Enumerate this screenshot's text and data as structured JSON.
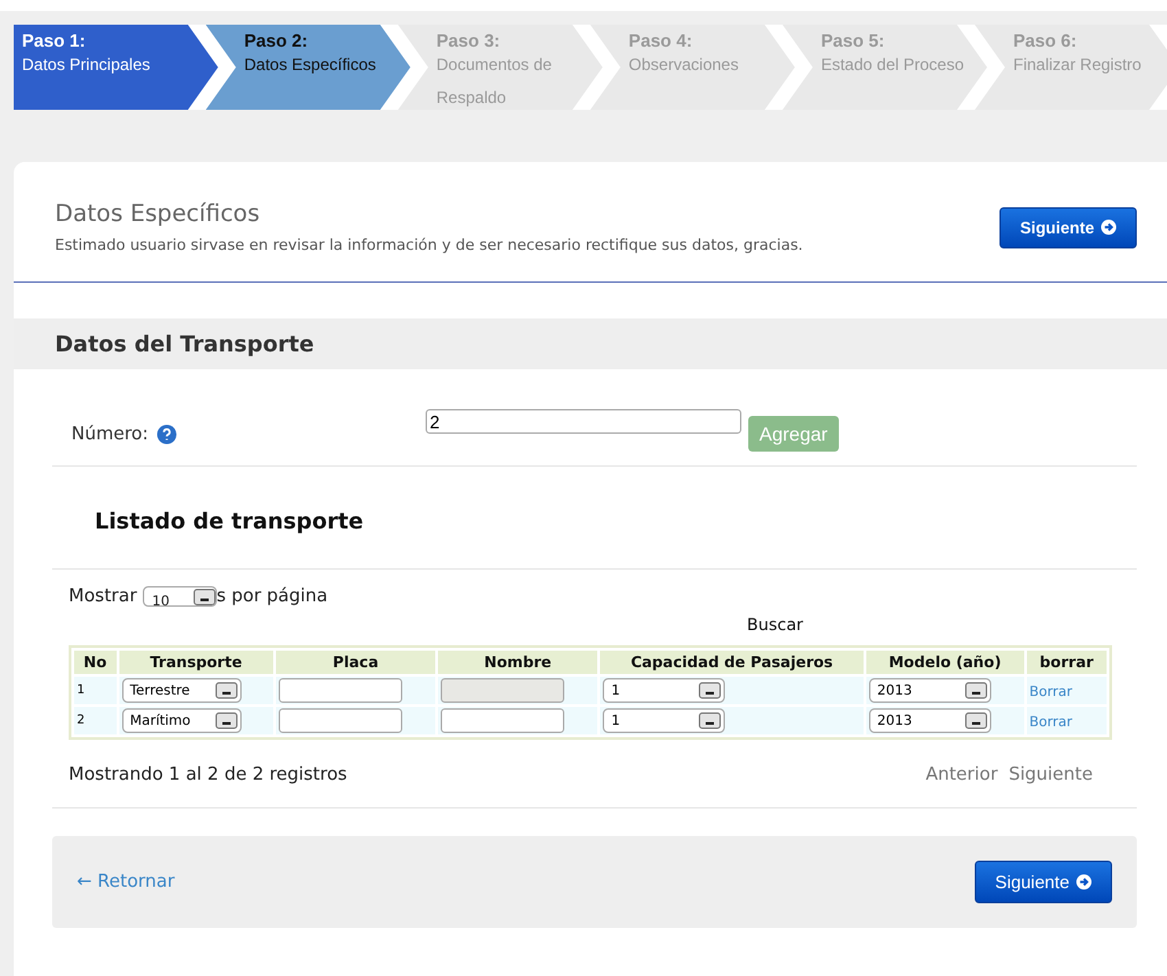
{
  "steps": [
    {
      "label": "Paso 1:",
      "name": "Datos Principales",
      "completed": true,
      "selected": false
    },
    {
      "label": "Paso 2:",
      "name": "Datos Específicos",
      "completed": false,
      "selected": true
    },
    {
      "label": "Paso 3:",
      "name": "Documentos de Respaldo",
      "completed": false,
      "selected": false
    },
    {
      "label": "Paso 4:",
      "name": "Observaciones",
      "completed": false,
      "selected": false
    },
    {
      "label": "Paso 5:",
      "name": "Estado del Proceso",
      "completed": false,
      "selected": false
    },
    {
      "label": "Paso 6:",
      "name": "Finalizar Registro",
      "completed": false,
      "selected": false
    }
  ],
  "header": {
    "title": "Datos Específicos",
    "subtitle": "Estimado usuario sirvase en revisar la información y de ser necesario rectifique sus datos, gracias.",
    "next_button": "Siguiente"
  },
  "section": {
    "title": "Datos del Transporte"
  },
  "numero": {
    "label": "Número:",
    "value": "2",
    "add_button": "Agregar"
  },
  "list_title": "Listado de transporte",
  "length": {
    "prefix": "Mostrar",
    "value": "10",
    "suffix": "s por página"
  },
  "search_label": "Buscar",
  "table": {
    "columns": [
      "No",
      "Transporte",
      "Placa",
      "Nombre",
      "Capacidad de Pasajeros",
      "Modelo (año)",
      "borrar"
    ],
    "rows": [
      {
        "no": "1",
        "transporte": "Terrestre",
        "nombre_disabled": true,
        "capacidad": "1",
        "modelo": "2013",
        "borrar": "Borrar"
      },
      {
        "no": "2",
        "transporte": "Marítimo",
        "nombre_disabled": false,
        "capacidad": "1",
        "modelo": "2013",
        "borrar": "Borrar"
      }
    ]
  },
  "info": "Mostrando 1 al 2 de 2 registros",
  "pagination": [
    "Anterior",
    "Siguiente"
  ],
  "footer": {
    "back_link": "← Retornar",
    "next_button": "Siguiente"
  }
}
